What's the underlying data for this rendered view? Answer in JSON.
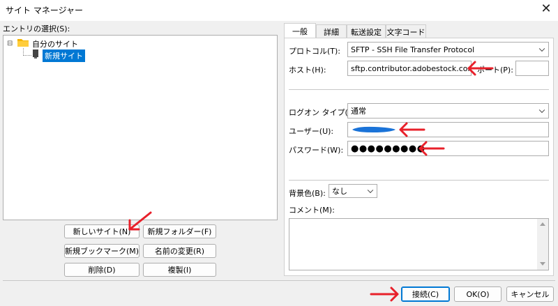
{
  "window": {
    "title": "サイト マネージャー",
    "close_symbol": "✕"
  },
  "left": {
    "entry_label": "エントリの選択(S):",
    "tree": {
      "root_label": "自分のサイト",
      "root_expander": "⊟",
      "child_label": "新規サイト"
    },
    "buttons": {
      "new_site": "新しいサイト(N)",
      "new_folder": "新規フォルダー(F)",
      "new_bookmark": "新規ブックマーク(M)",
      "rename": "名前の変更(R)",
      "delete": "削除(D)",
      "duplicate": "複製(I)"
    }
  },
  "tabs": [
    "一般",
    "詳細",
    "転送設定",
    "文字コード"
  ],
  "general": {
    "protocol_label": "プロトコル(T):",
    "protocol_value": "SFTP - SSH File Transfer Protocol",
    "host_label": "ホスト(H):",
    "host_value": "sftp.contributor.adobestock.com",
    "port_label": "ポート(P):",
    "port_value": "",
    "logon_label": "ログオン タイプ(L):",
    "logon_value": "通常",
    "user_label": "ユーザー(U):",
    "password_label": "パスワード(W):",
    "password_value": "●●●●●●●●●",
    "bgcolor_label": "背景色(B):",
    "bgcolor_value": "なし",
    "comment_label": "コメント(M):"
  },
  "footer": {
    "connect": "接続(C)",
    "ok": "OK(O)",
    "cancel": "キャンセル"
  },
  "colors": {
    "accent": "#0078d4",
    "annotation": "#e8202a",
    "redacted_user": "#1a73d8"
  },
  "icons": [
    "close-icon",
    "folder-icon",
    "server-icon",
    "chevron-down-icon",
    "scroll-up-icon",
    "scroll-down-icon",
    "red-arrow-icon"
  ]
}
